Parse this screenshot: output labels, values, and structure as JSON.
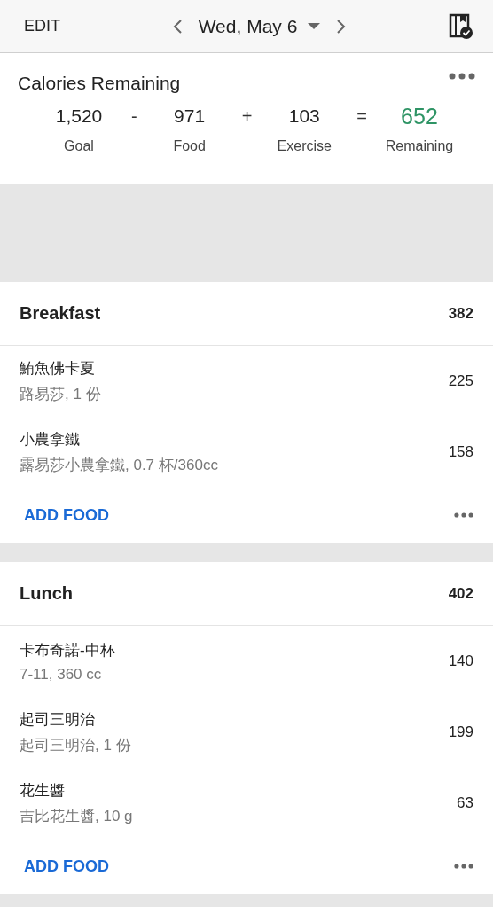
{
  "header": {
    "edit": "EDIT",
    "date": "Wed, May 6"
  },
  "summary": {
    "title": "Calories Remaining",
    "goal": {
      "value": "1,520",
      "label": "Goal"
    },
    "op1": "-",
    "food": {
      "value": "971",
      "label": "Food"
    },
    "op2": "+",
    "exercise": {
      "value": "103",
      "label": "Exercise"
    },
    "op3": "=",
    "remaining": {
      "value": "652",
      "label": "Remaining"
    }
  },
  "meals": [
    {
      "name": "Breakfast",
      "total": "382",
      "action": "ADD FOOD",
      "items": [
        {
          "name": "鮪魚佛卡夏",
          "detail": "路易莎, 1 份",
          "calories": "225"
        },
        {
          "name": "小農拿鐵",
          "detail": "露易莎小農拿鐵, 0.7 杯/360cc",
          "calories": "158"
        }
      ]
    },
    {
      "name": "Lunch",
      "total": "402",
      "action": "ADD FOOD",
      "items": [
        {
          "name": "卡布奇諾-中杯",
          "detail": "7-11, 360 cc",
          "calories": "140"
        },
        {
          "name": "起司三明治",
          "detail": "起司三明治, 1 份",
          "calories": "199"
        },
        {
          "name": "花生醬",
          "detail": "吉比花生醬, 10 g",
          "calories": "63"
        }
      ]
    }
  ]
}
